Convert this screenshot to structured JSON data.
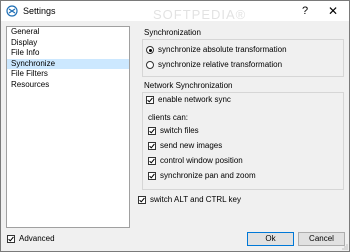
{
  "window": {
    "title": "Settings",
    "help": "?",
    "close": "✕"
  },
  "watermark": "SOFTPEDIA®",
  "nav": [
    {
      "label": "General",
      "selected": false
    },
    {
      "label": "Display",
      "selected": false
    },
    {
      "label": "File Info",
      "selected": false
    },
    {
      "label": "Synchronize",
      "selected": true
    },
    {
      "label": "File Filters",
      "selected": false
    },
    {
      "label": "Resources",
      "selected": false
    }
  ],
  "sync": {
    "title": "Synchronization",
    "absolute_label": "synchronize absolute transformation",
    "absolute_selected": true,
    "relative_label": "synchronize relative transformation",
    "relative_selected": false
  },
  "network": {
    "title": "Network Synchronization",
    "enable_label": "enable network sync",
    "enable_checked": true,
    "clients_label": "clients can:",
    "switch_files_label": "switch files",
    "switch_files_checked": true,
    "send_images_label": "send new images",
    "send_images_checked": true,
    "control_window_label": "control window position",
    "control_window_checked": true,
    "pan_zoom_label": "synchronize pan and zoom",
    "pan_zoom_checked": true
  },
  "alt_ctrl": {
    "label": "switch ALT and CTRL key",
    "checked": true
  },
  "advanced": {
    "label": "Advanced",
    "checked": true
  },
  "buttons": {
    "ok": "Ok",
    "cancel": "Cancel"
  }
}
